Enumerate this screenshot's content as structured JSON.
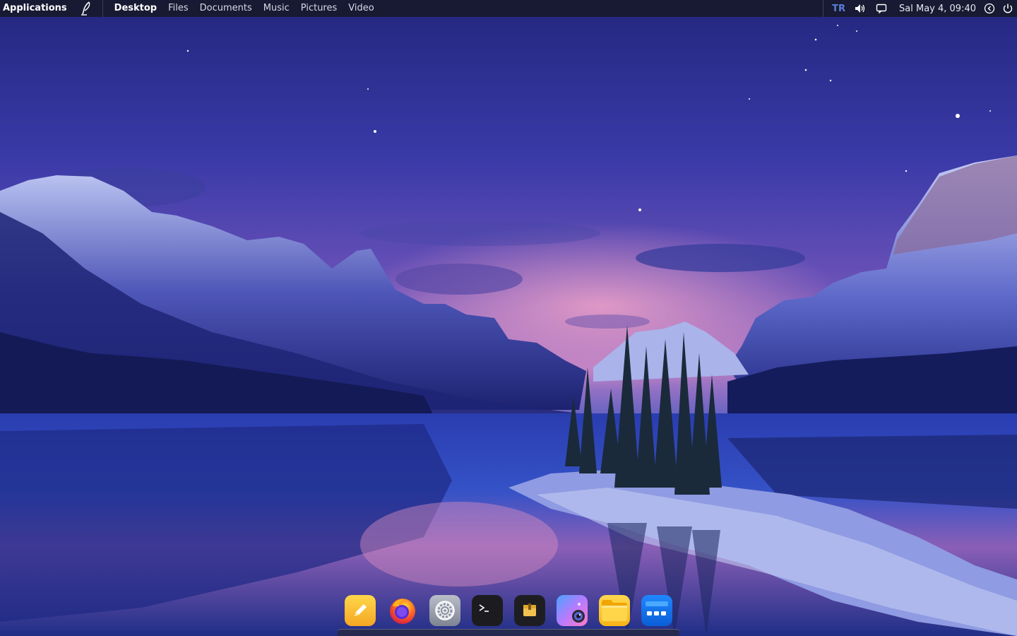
{
  "top_panel": {
    "applications_label": "Applications",
    "places": [
      "Desktop",
      "Files",
      "Documents",
      "Music",
      "Pictures",
      "Video"
    ],
    "active_place": "Desktop",
    "keyboard_layout": "TR",
    "clock": "Sal May  4, 09:40",
    "icons": [
      "quill-icon",
      "volume-icon",
      "notification-icon",
      "logout-icon",
      "power-icon"
    ]
  },
  "dock": {
    "items": [
      {
        "name": "text-editor",
        "icon": "pencil-icon"
      },
      {
        "name": "firefox",
        "icon": "firefox-icon"
      },
      {
        "name": "settings",
        "icon": "gear-icon"
      },
      {
        "name": "terminal",
        "icon": "terminal-icon"
      },
      {
        "name": "archive-manager",
        "icon": "archive-icon"
      },
      {
        "name": "screenshot",
        "icon": "camera-icon"
      },
      {
        "name": "file-manager",
        "icon": "folder-icon"
      },
      {
        "name": "app-grid",
        "icon": "app-grid-icon"
      }
    ]
  },
  "colors": {
    "panel_bg": "#181a33",
    "keyboard_layout": "#5a7fd6",
    "sky_top": "#2c2f93",
    "sky_mid": "#6a4fb8",
    "horizon": "#d98fc0"
  }
}
